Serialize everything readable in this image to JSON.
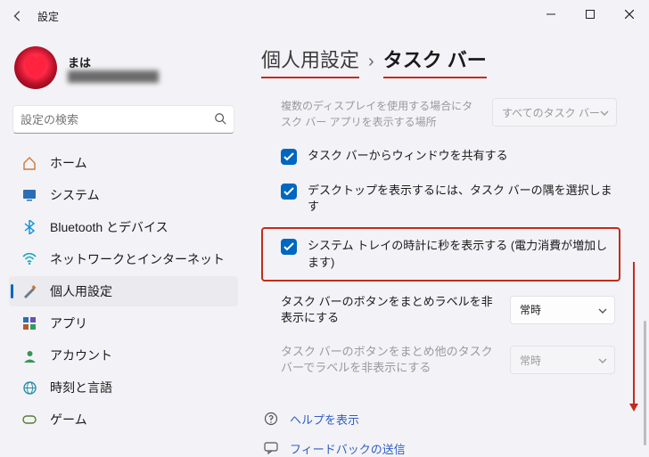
{
  "window": {
    "title": "設定"
  },
  "user": {
    "name": "まは",
    "email_masked": "████████████"
  },
  "search": {
    "placeholder": "設定の検索"
  },
  "nav": {
    "items": [
      {
        "key": "home",
        "label": "ホーム"
      },
      {
        "key": "system",
        "label": "システム"
      },
      {
        "key": "bluetooth",
        "label": "Bluetooth とデバイス"
      },
      {
        "key": "network",
        "label": "ネットワークとインターネット"
      },
      {
        "key": "personalization",
        "label": "個人用設定"
      },
      {
        "key": "apps",
        "label": "アプリ"
      },
      {
        "key": "accounts",
        "label": "アカウント"
      },
      {
        "key": "timelang",
        "label": "時刻と言語"
      },
      {
        "key": "gaming",
        "label": "ゲーム"
      }
    ],
    "selected_index": 4
  },
  "breadcrumb": {
    "parent": "個人用設定",
    "current": "タスク バー"
  },
  "options": {
    "multi_display_note": "複数のディスプレイを使用する場合にタスク バー アプリを表示する場所",
    "multi_display_dropdown": "すべてのタスク バー",
    "share_window": "タスク バーからウィンドウを共有する",
    "show_desktop": "デスクトップを表示するには、タスク バーの隅を選択します",
    "seconds_in_clock": "システム トレイの時計に秒を表示する (電力消費が増加します)",
    "combine_label": "タスク バーのボタンをまとめラベルを非表示にする",
    "combine_value": "常時",
    "combine_other_label": "タスク バーのボタンをまとめ他のタスク バーでラベルを非表示にする",
    "combine_other_value": "常時"
  },
  "footer": {
    "help": "ヘルプを表示",
    "feedback": "フィードバックの送信"
  }
}
